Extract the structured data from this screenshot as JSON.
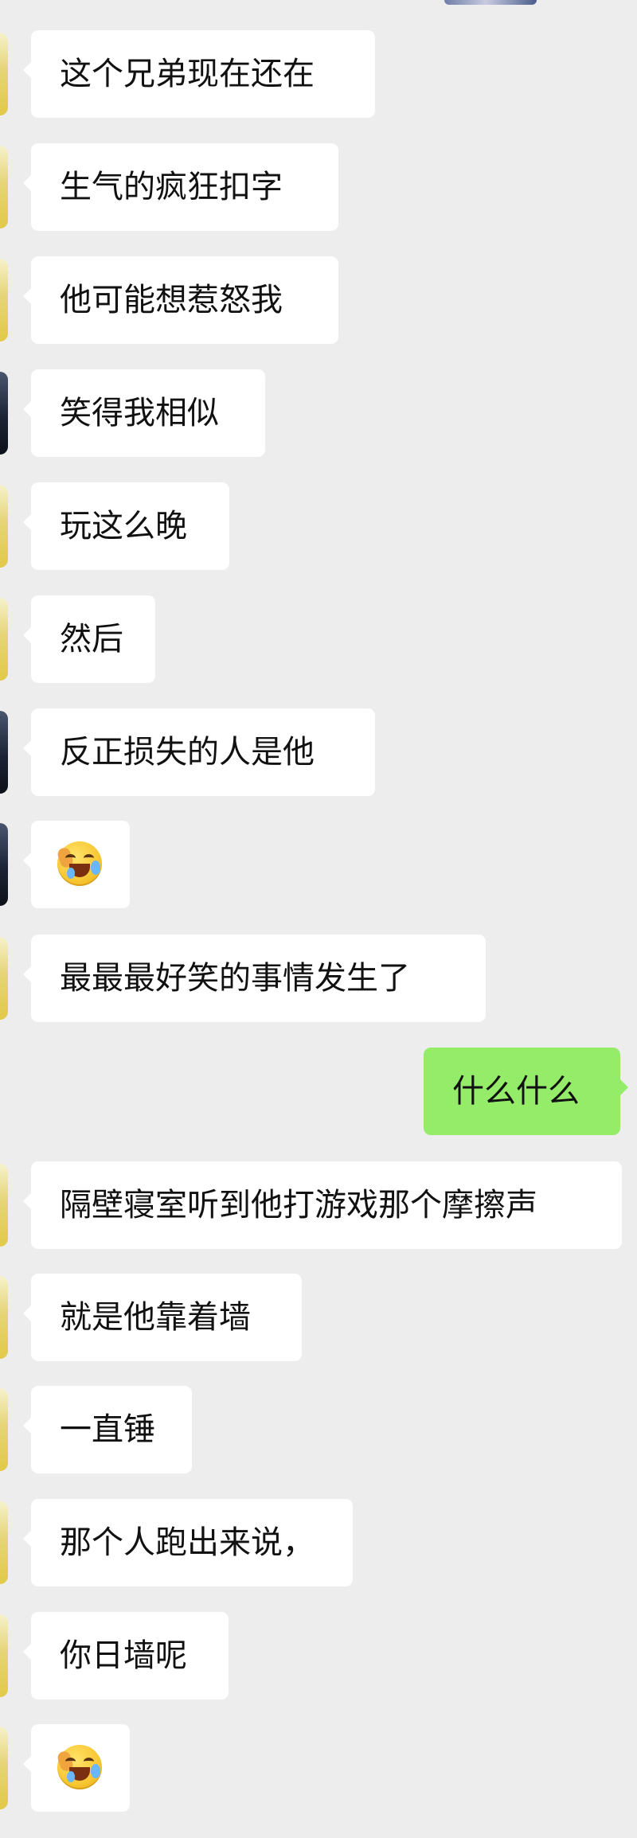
{
  "chat": {
    "messages": [
      {
        "text": "这个兄弟现在还在"
      },
      {
        "text": "生气的疯狂扣字"
      },
      {
        "text": "他可能想惹怒我"
      },
      {
        "text": "笑得我相似"
      },
      {
        "text": "玩这么晚"
      },
      {
        "text": "然后"
      },
      {
        "text": "反正损失的人是他"
      },
      {
        "emoji": "crying-laughing-face"
      },
      {
        "text": "最最最好笑的事情发生了"
      },
      {
        "text": "什么什么"
      },
      {
        "text": "隔壁寝室听到他打游戏那个摩擦声"
      },
      {
        "text": "就是他靠着墙"
      },
      {
        "text": "一直锤"
      },
      {
        "text": "那个人跑出来说，"
      },
      {
        "text": "你日墙呢"
      },
      {
        "emoji": "crying-laughing-face"
      }
    ]
  },
  "colors": {
    "background": "#ededed",
    "incoming_bubble": "#ffffff",
    "outgoing_bubble": "#95ec69"
  }
}
